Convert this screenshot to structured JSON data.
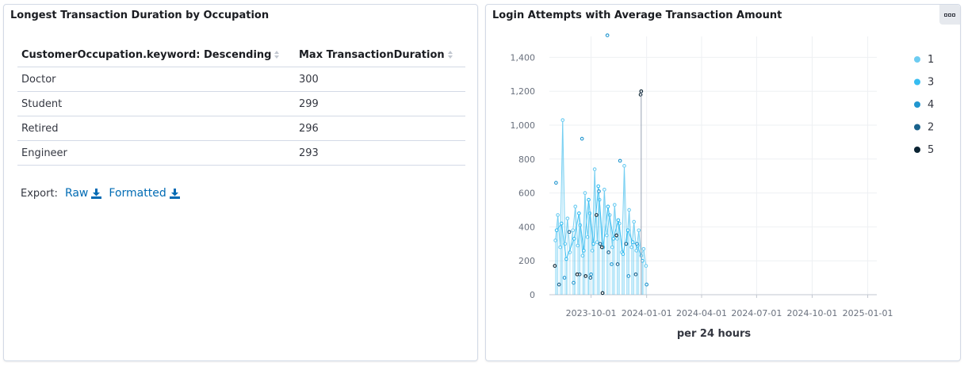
{
  "left_panel": {
    "title": "Longest Transaction Duration by Occupation",
    "columns": [
      "CustomerOccupation.keyword: Descending",
      "Max TransactionDuration"
    ],
    "rows": [
      [
        "Doctor",
        "300"
      ],
      [
        "Student",
        "299"
      ],
      [
        "Retired",
        "296"
      ],
      [
        "Engineer",
        "293"
      ]
    ],
    "export_label": "Export:",
    "raw_label": "Raw",
    "formatted_label": "Formatted"
  },
  "right_panel": {
    "title": "Login Attempts with Average Transaction Amount"
  },
  "chart_data": {
    "type": "scatter",
    "title": "Login Attempts with Average Transaction Amount",
    "xlabel": "per 24 hours",
    "ylabel": "",
    "x_ticks": [
      "2023-10-01",
      "2024-01-01",
      "2024-04-01",
      "2024-07-01",
      "2024-10-01",
      "2025-01-01"
    ],
    "y_ticks": [
      0,
      200,
      400,
      600,
      800,
      1000,
      1200,
      1400
    ],
    "ylim": [
      0,
      1500
    ],
    "grid": true,
    "legend_position": "right",
    "legend": [
      {
        "name": "1",
        "color": "#6dccf1"
      },
      {
        "name": "3",
        "color": "#36bdf1"
      },
      {
        "name": "4",
        "color": "#2196cf"
      },
      {
        "name": "2",
        "color": "#19628c"
      },
      {
        "name": "5",
        "color": "#0b2433"
      }
    ],
    "series": [
      {
        "name": "1",
        "x": [
          "2023-08-03",
          "2023-08-07",
          "2023-08-11",
          "2023-08-15",
          "2023-08-19",
          "2023-08-23",
          "2023-08-27",
          "2023-09-01",
          "2023-09-05",
          "2023-09-09",
          "2023-09-13",
          "2023-09-17",
          "2023-09-21",
          "2023-09-25",
          "2023-09-29",
          "2023-10-03",
          "2023-10-07",
          "2023-10-11",
          "2023-10-15",
          "2023-10-19",
          "2023-10-23",
          "2023-10-27",
          "2023-11-01",
          "2023-11-05",
          "2023-11-09",
          "2023-11-13",
          "2023-11-17",
          "2023-11-21",
          "2023-11-25",
          "2023-11-29",
          "2023-12-03",
          "2023-12-07",
          "2023-12-11",
          "2023-12-15",
          "2023-12-19",
          "2023-12-23",
          "2023-12-27",
          "2023-12-31"
        ],
        "values": [
          320,
          470,
          280,
          1030,
          300,
          450,
          250,
          380,
          520,
          290,
          410,
          230,
          600,
          340,
          480,
          260,
          740,
          310,
          560,
          290,
          620,
          350,
          470,
          280,
          530,
          330,
          420,
          250,
          760,
          300,
          500,
          280,
          430,
          260,
          380,
          230,
          270,
          170
        ]
      },
      {
        "name": "3",
        "x": [
          "2023-08-05",
          "2023-08-13",
          "2023-08-21",
          "2023-09-03",
          "2023-09-11",
          "2023-09-19",
          "2023-09-27",
          "2023-10-05",
          "2023-10-13",
          "2023-10-21",
          "2023-10-29",
          "2023-11-07",
          "2023-11-15",
          "2023-11-23",
          "2023-12-01",
          "2023-12-09",
          "2023-12-17",
          "2023-12-25"
        ],
        "values": [
          380,
          420,
          210,
          330,
          480,
          260,
          560,
          300,
          640,
          280,
          520,
          330,
          440,
          240,
          380,
          310,
          290,
          200
        ]
      },
      {
        "name": "4",
        "x": [
          "2023-08-04",
          "2023-08-18",
          "2023-09-02",
          "2023-09-16",
          "2023-10-01",
          "2023-10-14",
          "2023-10-28",
          "2023-11-04",
          "2023-11-18",
          "2023-12-02",
          "2023-12-16",
          "2024-01-01"
        ],
        "values": [
          660,
          100,
          70,
          920,
          120,
          610,
          1530,
          180,
          790,
          110,
          300,
          60
        ]
      },
      {
        "name": "2",
        "x": [
          "2023-08-09",
          "2023-08-26",
          "2023-09-12",
          "2023-09-30",
          "2023-10-16",
          "2023-10-30",
          "2023-11-14",
          "2023-11-28",
          "2023-12-14"
        ],
        "values": [
          60,
          370,
          120,
          100,
          300,
          250,
          180,
          300,
          120
        ]
      },
      {
        "name": "5",
        "x": [
          "2023-08-02",
          "2023-09-08",
          "2023-09-22",
          "2023-10-10",
          "2023-10-19",
          "2023-10-20",
          "2023-11-12",
          "2023-12-22",
          "2023-12-23"
        ],
        "values": [
          170,
          120,
          110,
          470,
          280,
          10,
          350,
          1180,
          1200
        ]
      }
    ]
  }
}
